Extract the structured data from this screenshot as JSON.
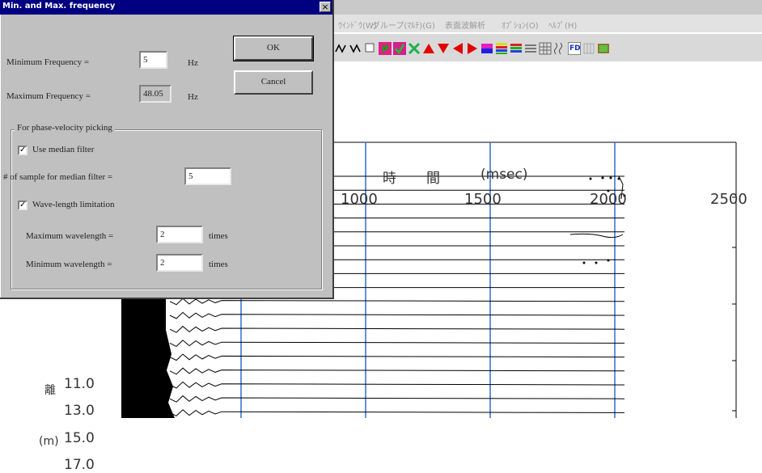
{
  "dialog": {
    "title": "Min. and Max. frequency",
    "close_glyph": "×",
    "min_freq_label": "Minimum Frequency =",
    "min_freq_value": "5",
    "min_freq_unit": "Hz",
    "max_freq_label": "Maximum Frequency =",
    "max_freq_value": "48.05",
    "max_freq_unit": "Hz",
    "ok_label": "OK",
    "cancel_label": "Cancel",
    "group_title": "For phase-velocity picking",
    "median_filter_label": "Use median filter",
    "median_filter_checked": true,
    "median_samples_label": "# of sample for median filter =",
    "median_samples_value": "5",
    "wavelength_limit_label": "Wave-length limitation",
    "wavelength_limit_checked": true,
    "max_wavelength_label": "Maximum wavelength =",
    "max_wavelength_value": "2",
    "max_wavelength_unit": "times",
    "min_wavelength_label": "Minimum wavelength =",
    "min_wavelength_value": "2",
    "min_wavelength_unit": "times"
  },
  "menu": {
    "items": [
      "ｳｲﾝﾄﾞｳ(W)",
      "グループ(ﾏﾙﾁ)(G)",
      "表面波解析",
      "ｵﾌﾟｼｮﾝ(O)",
      "ﾍﾙﾌﾟ(H)"
    ]
  },
  "plot": {
    "time_axis_title": [
      "時",
      "間",
      "(msec)"
    ],
    "time_ticks": [
      "1000",
      "1500",
      "2000",
      "2500"
    ],
    "distance_ticks": [
      "11.0",
      "13.0",
      "15.0",
      "17.0"
    ],
    "distance_axis_title": [
      "離",
      "(m)"
    ],
    "colors": {
      "grid": "#2f6fcf",
      "trace": "#000000"
    }
  },
  "toolbar": {
    "icons": [
      "wave-up-icon",
      "wave-down-icon",
      "select-icon",
      "p-pick-icon",
      "check-icon",
      "cross-icon",
      "triangle-up-icon",
      "triangle-down-icon",
      "triangle-left-icon",
      "triangle-right-icon",
      "color-bar-icon",
      "color-bars-icon",
      "rgb-bars-icon",
      "gray-bars-icon",
      "grid-icon",
      "wiggle-icon",
      "fd-icon",
      "disabled-icon",
      "image-icon"
    ],
    "fd_label": "FD"
  }
}
